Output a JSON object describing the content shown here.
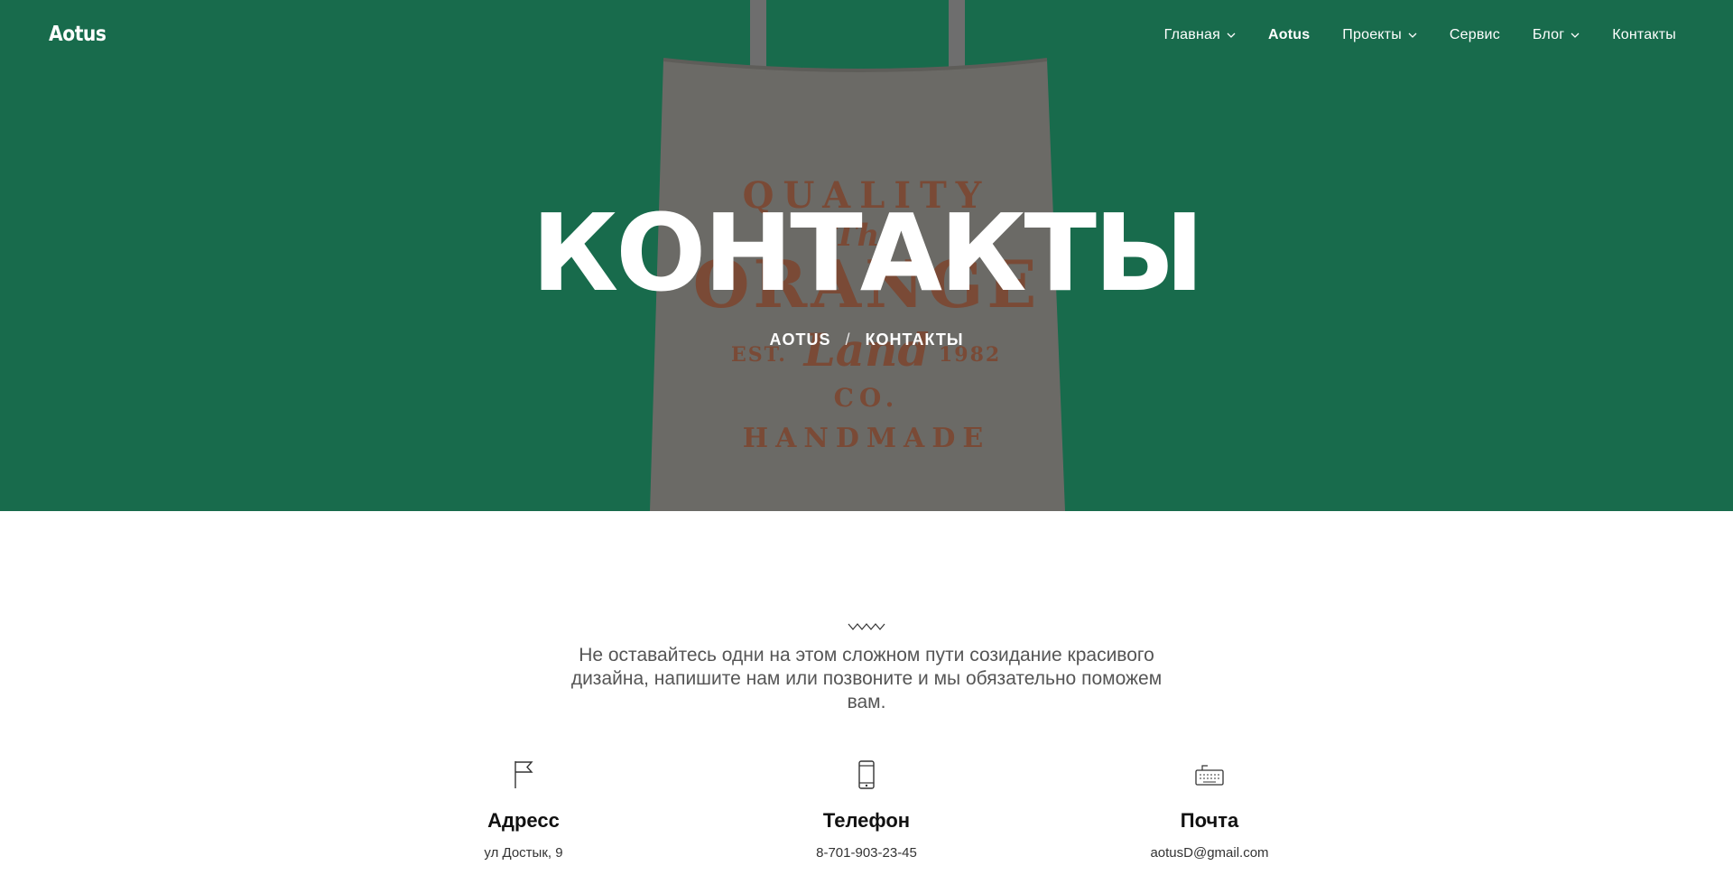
{
  "header": {
    "logo": "Aotus",
    "nav": [
      {
        "label": "Главная",
        "dropdown": true
      },
      {
        "label": "Aotus",
        "dropdown": false,
        "active": true
      },
      {
        "label": "Проекты",
        "dropdown": true
      },
      {
        "label": "Сервис",
        "dropdown": false
      },
      {
        "label": "Блог",
        "dropdown": true
      },
      {
        "label": "Контакты",
        "dropdown": false
      }
    ]
  },
  "hero": {
    "title": "КОНТАКТЫ",
    "breadcrumb": {
      "home": "AOTUS",
      "separator": "/",
      "current": "КОНТАКТЫ"
    },
    "background_color": "#186b4c"
  },
  "intro_text": "Не оставайтесь одни на этом сложном пути созидание красивого дизайна, напишите нам или позвоните и мы обязательно поможем вам.",
  "contacts": [
    {
      "icon": "flag-icon",
      "title": "Адресс",
      "value": "ул Достык, 9"
    },
    {
      "icon": "phone-icon",
      "title": "Телефон",
      "value": "8-701-903-23-45"
    },
    {
      "icon": "keyboard-icon",
      "title": "Почта",
      "value": "aotusD@gmail.com"
    }
  ]
}
